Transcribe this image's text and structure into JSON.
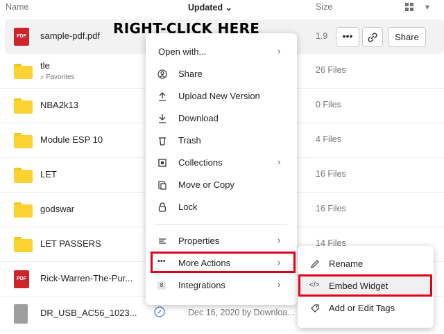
{
  "header": {
    "name_label": "Name",
    "updated_label": "Updated",
    "updated_sort_glyph": "⌄",
    "size_label": "Size",
    "view_toggle_icon": "grid-icon",
    "view_chevron_glyph": "▾"
  },
  "callout": "RIGHT-CLICK HERE",
  "rows": [
    {
      "name": "sample-pdf.pdf",
      "type": "pdf",
      "size": "1.9"
    },
    {
      "name": "tle",
      "type": "folder",
      "sub": "Favorites",
      "size": "26 Files"
    },
    {
      "name": "NBA2k13",
      "type": "folder",
      "size": "0 Files"
    },
    {
      "name": "Module ESP 10",
      "type": "folder",
      "size": "4 Files"
    },
    {
      "name": "LET",
      "type": "folder",
      "size": "16 Files"
    },
    {
      "name": "godswar",
      "type": "folder",
      "size": "16 Files"
    },
    {
      "name": "LET PASSERS",
      "type": "folder",
      "size": "14 Files"
    },
    {
      "name": "Rick-Warren-The-Pur...",
      "type": "pdf",
      "size": ""
    },
    {
      "name": "DR_USB_AC56_1023...",
      "type": "file",
      "updated": "Dec 16, 2020 by Downloa..."
    }
  ],
  "pdf_icon_label": "PDF",
  "selected_row_actions": {
    "more_glyph": "•••",
    "share_label": "Share"
  },
  "context_menu": {
    "items": [
      {
        "label": "Open with...",
        "has_submenu": true
      },
      {
        "label": "Share",
        "icon": "share-icon"
      },
      {
        "label": "Upload New Version",
        "icon": "upload-icon"
      },
      {
        "label": "Download",
        "icon": "download-icon"
      },
      {
        "label": "Trash",
        "icon": "trash-icon"
      },
      {
        "label": "Collections",
        "icon": "collections-icon",
        "has_submenu": true
      },
      {
        "label": "Move or Copy",
        "icon": "move-copy-icon"
      },
      {
        "label": "Lock",
        "icon": "lock-icon"
      },
      {
        "label": "Properties",
        "icon": "properties-icon",
        "has_submenu": true
      },
      {
        "label": "More Actions",
        "icon": "more-icon",
        "has_submenu": true
      },
      {
        "label": "Integrations",
        "icon": "integrations-icon",
        "has_submenu": true
      }
    ],
    "more_glyph": "•••",
    "integrations_badge": "8",
    "arrow_glyph": "›"
  },
  "submenu": {
    "items": [
      {
        "label": "Rename",
        "icon": "pencil-icon"
      },
      {
        "label": "Embed Widget",
        "icon": "code-icon"
      },
      {
        "label": "Add or Edit Tags",
        "icon": "tag-icon"
      }
    ],
    "code_glyph": "</>"
  },
  "colors": {
    "highlight_red": "#e0001b",
    "pdf_red": "#d0242c",
    "folder_yellow": "#fbd232",
    "selected_row_bg": "#f2f2f2"
  }
}
